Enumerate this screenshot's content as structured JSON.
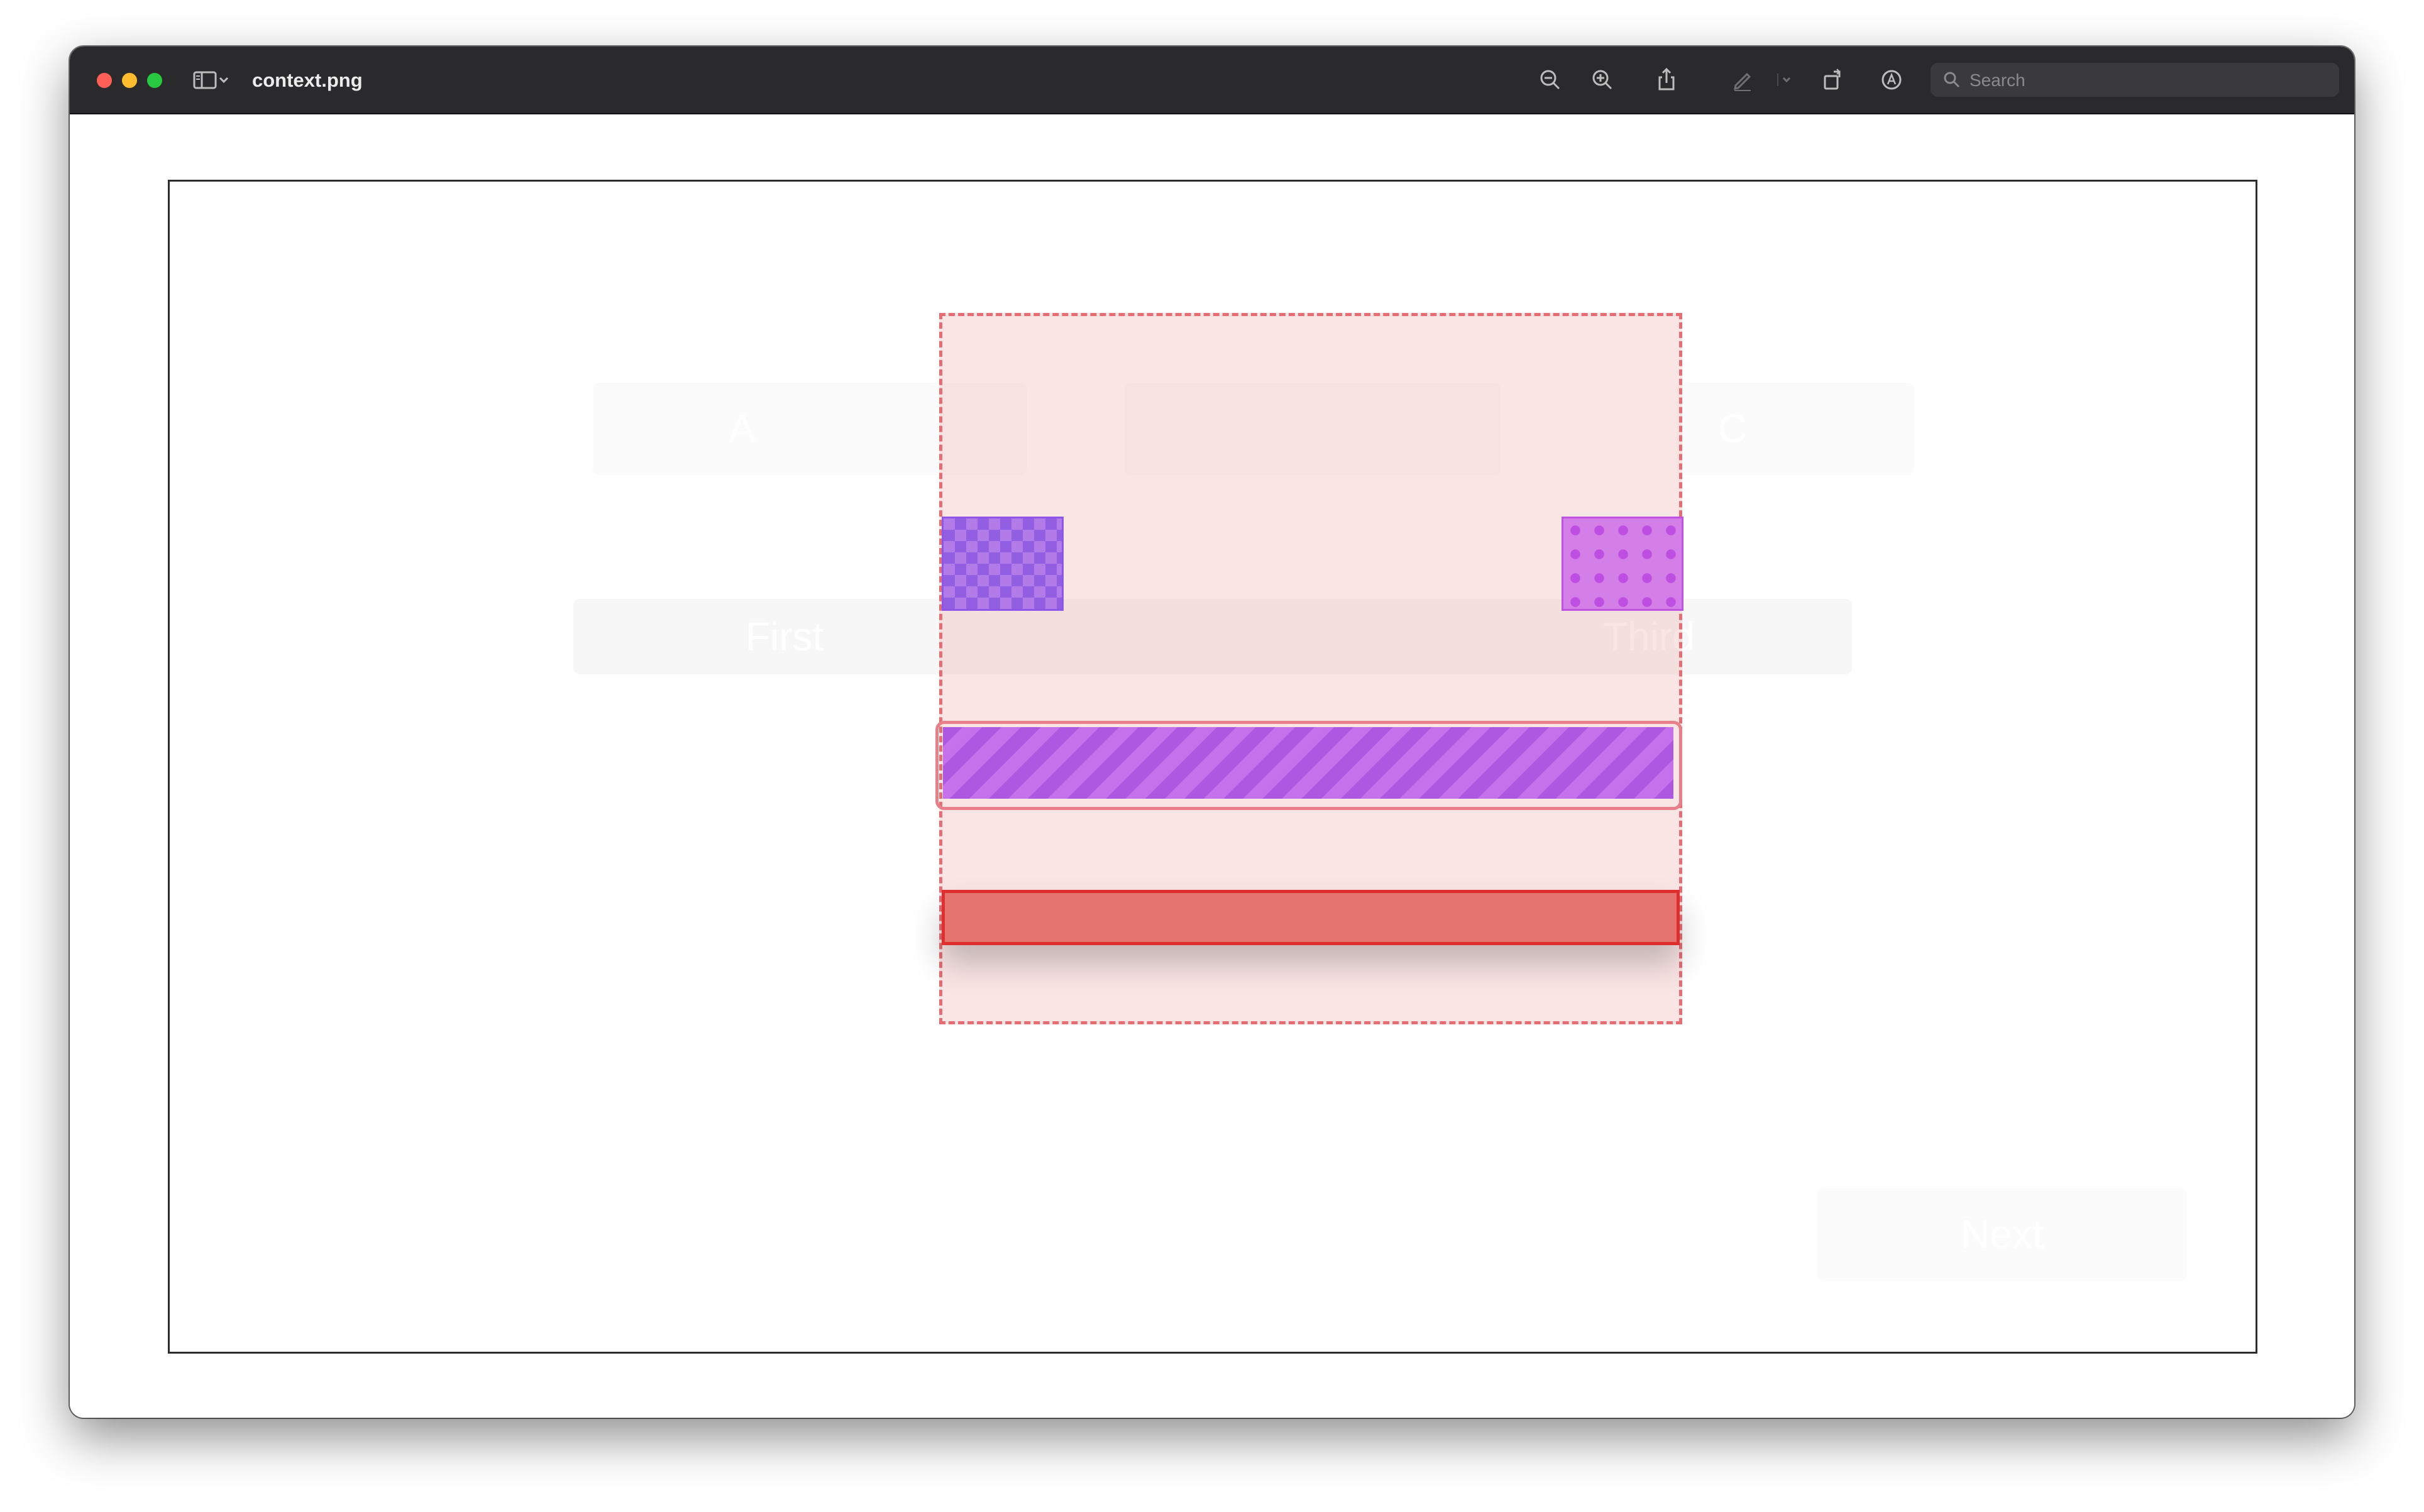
{
  "window": {
    "title": "context.png",
    "traffic_lights": {
      "close": "#ff5f57",
      "minimize": "#febc2e",
      "zoom": "#28c840"
    }
  },
  "toolbar": {
    "icons": [
      "sidebar-toggle-icon",
      "chevron-down-icon",
      "zoom-out-icon",
      "zoom-in-icon",
      "share-icon",
      "markup-pen-icon",
      "chevron-down-icon",
      "rotate-icon",
      "annotate-icon",
      "search-icon"
    ],
    "search_placeholder": "Search"
  },
  "image": {
    "faded_labels": {
      "slot_a": "A",
      "slot_c": "C",
      "option_first": "First",
      "option_third": "Third",
      "next_button": "Next"
    },
    "overlay_colors": {
      "dashed_region": "#e46e74",
      "checker_box": "#8e56e8",
      "dotted_box": "#c052e2",
      "striped_bar": "#c06ae8",
      "red_bar": "#e57470"
    }
  }
}
